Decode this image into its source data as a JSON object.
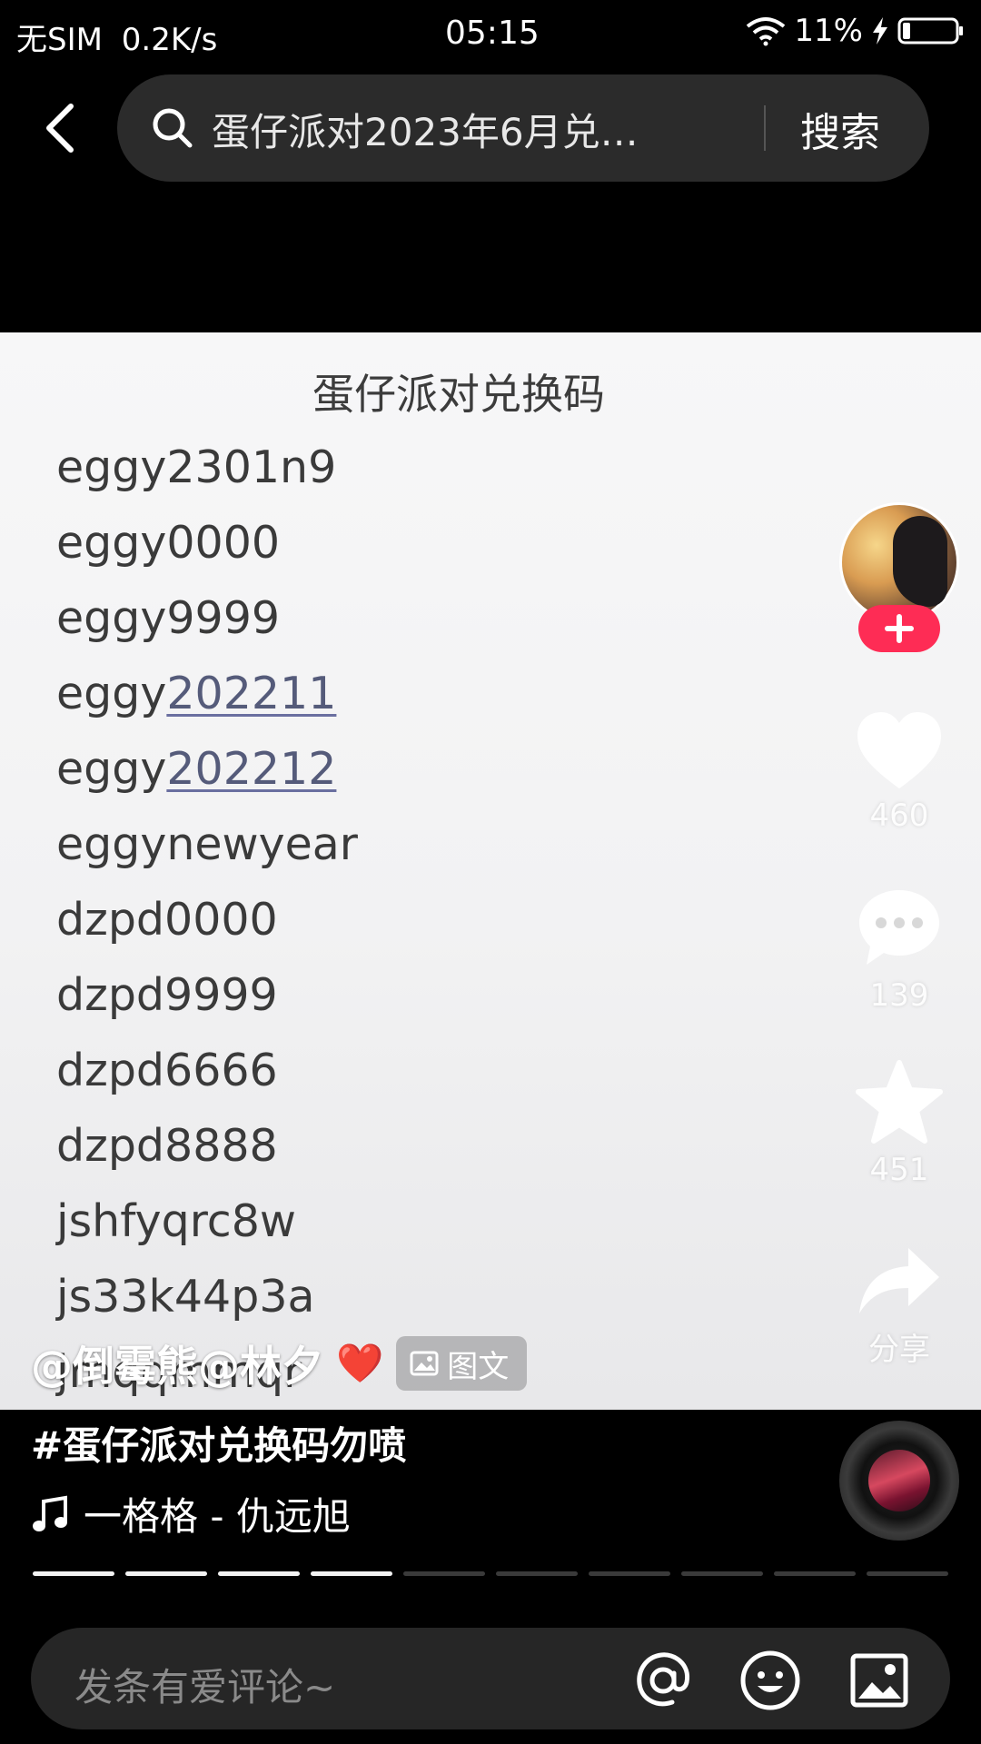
{
  "status_bar": {
    "carrier": "无SIM",
    "net_speed": "0.2K/s",
    "time": "05:15",
    "battery": "11%"
  },
  "header": {
    "search_query": "蛋仔派对2023年6月兑…",
    "search_button": "搜索"
  },
  "content": {
    "title": "蛋仔派对兑换码",
    "codes": [
      {
        "prefix": "eggy2301n9",
        "link": ""
      },
      {
        "prefix": "eggy0000",
        "link": ""
      },
      {
        "prefix": "eggy9999",
        "link": ""
      },
      {
        "prefix": "eggy",
        "link": "202211"
      },
      {
        "prefix": "eggy",
        "link": "202212"
      },
      {
        "prefix": "eggynewyear",
        "link": ""
      },
      {
        "prefix": "dzpd0000",
        "link": ""
      },
      {
        "prefix": "dzpd9999",
        "link": ""
      },
      {
        "prefix": "dzpd6666",
        "link": ""
      },
      {
        "prefix": "dzpd8888",
        "link": ""
      },
      {
        "prefix": "jshfyqrc8w",
        "link": ""
      },
      {
        "prefix": "js33k44p3a",
        "link": ""
      },
      {
        "prefix": "jmqqmmqr",
        "link": ""
      }
    ]
  },
  "actions": {
    "like_count": "460",
    "comment_count": "139",
    "favorite_count": "451",
    "share_label": "分享"
  },
  "caption": {
    "author": "@倒霉熊@林夕",
    "heart": "❤️",
    "post_type": "图文",
    "hashtag": "#蛋仔派对兑换码勿喷",
    "music": "一格格 - 仇远旭"
  },
  "progress": {
    "total_pages": 10,
    "viewed_pages": 4
  },
  "comment_bar": {
    "placeholder": "发条有爱评论~"
  },
  "colors": {
    "accent": "#fe2c55",
    "background": "#000000",
    "search_box": "#2b2b2b"
  }
}
